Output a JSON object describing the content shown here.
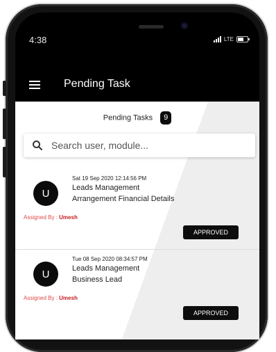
{
  "status_bar": {
    "time": "4:38",
    "network": "LTE"
  },
  "app_bar": {
    "title": "Pending Task"
  },
  "pending": {
    "label": "Pending Tasks",
    "count": "9"
  },
  "search": {
    "placeholder": "Search user, module..."
  },
  "tasks": [
    {
      "avatar_letter": "U",
      "timestamp": "Sat 19 Sep 2020 12:14:56 PM",
      "module": "Leads Management",
      "detail": "Arrangement Financial Details",
      "assigned_label": "Assigned By :",
      "assigned_by": "Umesh",
      "status": "APPROVED"
    },
    {
      "avatar_letter": "U",
      "timestamp": "Tue 08 Sep 2020 08:34:57 PM",
      "module": "Leads Management",
      "detail": "Business Lead",
      "assigned_label": "Assigned By :",
      "assigned_by": "Umesh",
      "status": "APPROVED"
    }
  ],
  "colors": {
    "accent": "#000000",
    "assigned_name": "#c41e1e",
    "badge": "#0c0c0c"
  },
  "icons": [
    "menu-icon",
    "search-icon",
    "signal-icon",
    "battery-icon"
  ]
}
